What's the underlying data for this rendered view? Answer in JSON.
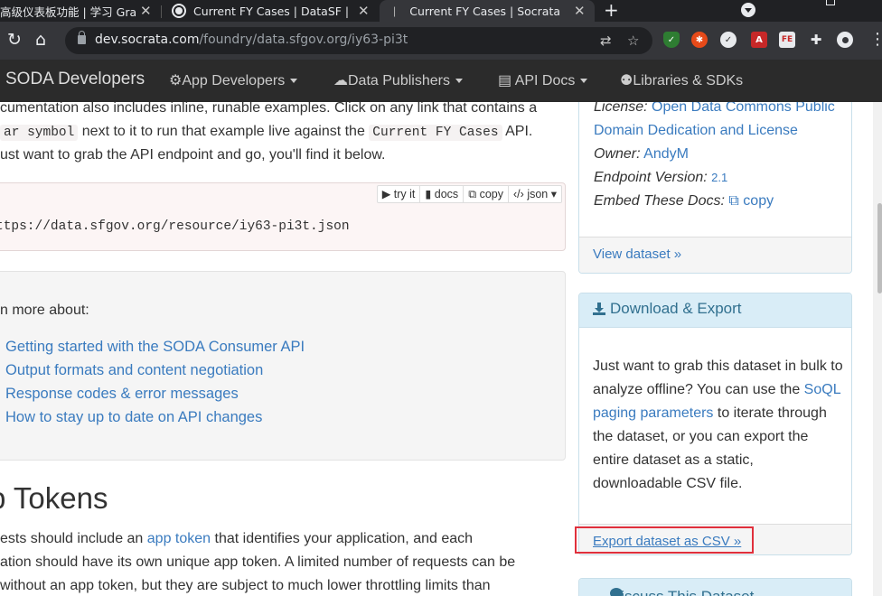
{
  "browser": {
    "tabs": [
      {
        "title": "高级仪表板功能 | 学习 Grafana"
      },
      {
        "title": "Current FY Cases | DataSF | City"
      },
      {
        "title": "Current FY Cases | Socrata API"
      }
    ],
    "new_tab_label": "+",
    "url_host": "dev.socrata.com",
    "url_path": "/foundry/data.sfgov.org/iy63-pi3t",
    "extensions": {
      "fe": "FE"
    }
  },
  "site": {
    "brand": "SODA Developers",
    "nav": [
      {
        "label": "App Developers",
        "icon": "gears-icon"
      },
      {
        "label": "Data Publishers",
        "icon": "cloud-upload-icon"
      },
      {
        "label": "API Docs",
        "icon": "book-icon"
      },
      {
        "label": "Libraries & SDKs",
        "icon": "robot-icon"
      }
    ]
  },
  "main": {
    "intro_line1": "cumentation also includes inline, runable examples. Click on any link that contains a",
    "intro_code1": "ar symbol",
    "intro_line2_mid": " next to it to run that example live against the ",
    "intro_code2": "Current FY Cases",
    "intro_line2_end": " API.",
    "intro_line3": "ust want to grab the API endpoint and go, you'll find it below.",
    "endpoint_tools": {
      "try": "try it",
      "docs": "docs",
      "copy": "copy",
      "json": "json"
    },
    "endpoint_url": "ttps://data.sfgov.org/resource/iy63-pi3t.json",
    "learn_head": "n more about:",
    "learn_links": [
      "Getting started with the SODA Consumer API",
      "Output formats and content negotiation",
      "Response codes & error messages",
      "How to stay up to date on API changes"
    ],
    "tokens_heading": "p Tokens",
    "tokens_p1_pre": "ests should include an ",
    "tokens_p1_link": "app token",
    "tokens_p1_post": " that identifies your application, and each",
    "tokens_p2": "ation should have its own unique app token. A limited number of requests can be",
    "tokens_p3": "without an app token, but they are subject to much lower throttling limits than"
  },
  "sidebar": {
    "license_label": "License:",
    "license_value_1": "Open Data Commons Public",
    "license_value_2": "Domain Dedication and License",
    "owner_label": "Owner:",
    "owner_value": "AndyM",
    "endpoint_version_label": "Endpoint Version:",
    "endpoint_version_value": "2.1",
    "embed_label": "Embed These Docs:",
    "embed_value": "copy",
    "view_dataset": "View dataset »",
    "download_title": "Download & Export",
    "download_text_1": "Just want to grab this dataset in bulk to analyze offline? You can use the ",
    "download_link": "SoQL paging parameters",
    "download_text_2": " to iterate through the dataset, or you can export the entire dataset as a static, downloadable CSV file.",
    "export_csv": "Export dataset as CSV »",
    "discuss_title": "Discuss This Dataset"
  }
}
